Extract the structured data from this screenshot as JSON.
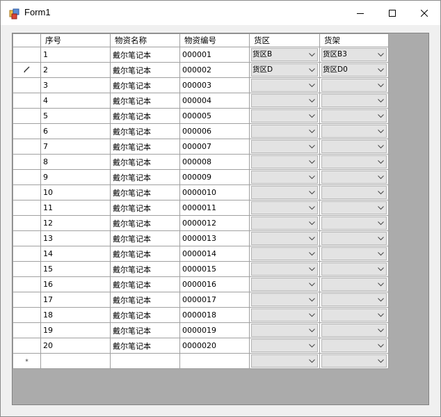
{
  "window": {
    "title": "Form1"
  },
  "grid": {
    "columns": [
      "序号",
      "物资名称",
      "物资编号",
      "货区",
      "货架"
    ],
    "rows": [
      {
        "no": "1",
        "name": "戴尔笔记本",
        "code": "000001",
        "area": "货区B",
        "shelf": "货区B3",
        "marker": ""
      },
      {
        "no": "2",
        "name": "戴尔笔记本",
        "code": "000002",
        "area": "货区D",
        "shelf": "货区D0",
        "marker": "pencil"
      },
      {
        "no": "3",
        "name": "戴尔笔记本",
        "code": "000003",
        "area": "",
        "shelf": "",
        "marker": ""
      },
      {
        "no": "4",
        "name": "戴尔笔记本",
        "code": "000004",
        "area": "",
        "shelf": "",
        "marker": ""
      },
      {
        "no": "5",
        "name": "戴尔笔记本",
        "code": "000005",
        "area": "",
        "shelf": "",
        "marker": ""
      },
      {
        "no": "6",
        "name": "戴尔笔记本",
        "code": "000006",
        "area": "",
        "shelf": "",
        "marker": ""
      },
      {
        "no": "7",
        "name": "戴尔笔记本",
        "code": "000007",
        "area": "",
        "shelf": "",
        "marker": ""
      },
      {
        "no": "8",
        "name": "戴尔笔记本",
        "code": "000008",
        "area": "",
        "shelf": "",
        "marker": ""
      },
      {
        "no": "9",
        "name": "戴尔笔记本",
        "code": "000009",
        "area": "",
        "shelf": "",
        "marker": ""
      },
      {
        "no": "10",
        "name": "戴尔笔记本",
        "code": "0000010",
        "area": "",
        "shelf": "",
        "marker": ""
      },
      {
        "no": "11",
        "name": "戴尔笔记本",
        "code": "0000011",
        "area": "",
        "shelf": "",
        "marker": ""
      },
      {
        "no": "12",
        "name": "戴尔笔记本",
        "code": "0000012",
        "area": "",
        "shelf": "",
        "marker": ""
      },
      {
        "no": "13",
        "name": "戴尔笔记本",
        "code": "0000013",
        "area": "",
        "shelf": "",
        "marker": ""
      },
      {
        "no": "14",
        "name": "戴尔笔记本",
        "code": "0000014",
        "area": "",
        "shelf": "",
        "marker": ""
      },
      {
        "no": "15",
        "name": "戴尔笔记本",
        "code": "0000015",
        "area": "",
        "shelf": "",
        "marker": ""
      },
      {
        "no": "16",
        "name": "戴尔笔记本",
        "code": "0000016",
        "area": "",
        "shelf": "",
        "marker": ""
      },
      {
        "no": "17",
        "name": "戴尔笔记本",
        "code": "0000017",
        "area": "",
        "shelf": "",
        "marker": ""
      },
      {
        "no": "18",
        "name": "戴尔笔记本",
        "code": "0000018",
        "area": "",
        "shelf": "",
        "marker": ""
      },
      {
        "no": "19",
        "name": "戴尔笔记本",
        "code": "0000019",
        "area": "",
        "shelf": "",
        "marker": ""
      },
      {
        "no": "20",
        "name": "戴尔笔记本",
        "code": "0000020",
        "area": "",
        "shelf": "",
        "marker": ""
      }
    ],
    "new_row_marker": "*"
  },
  "colors": {
    "grid_background": "#ababab",
    "window_background": "#f0f0f0",
    "combo_background": "#e3e3e3"
  },
  "icons": [
    "app-icon",
    "minimize-icon",
    "maximize-icon",
    "close-icon",
    "chevron-down-icon",
    "pencil-icon"
  ]
}
